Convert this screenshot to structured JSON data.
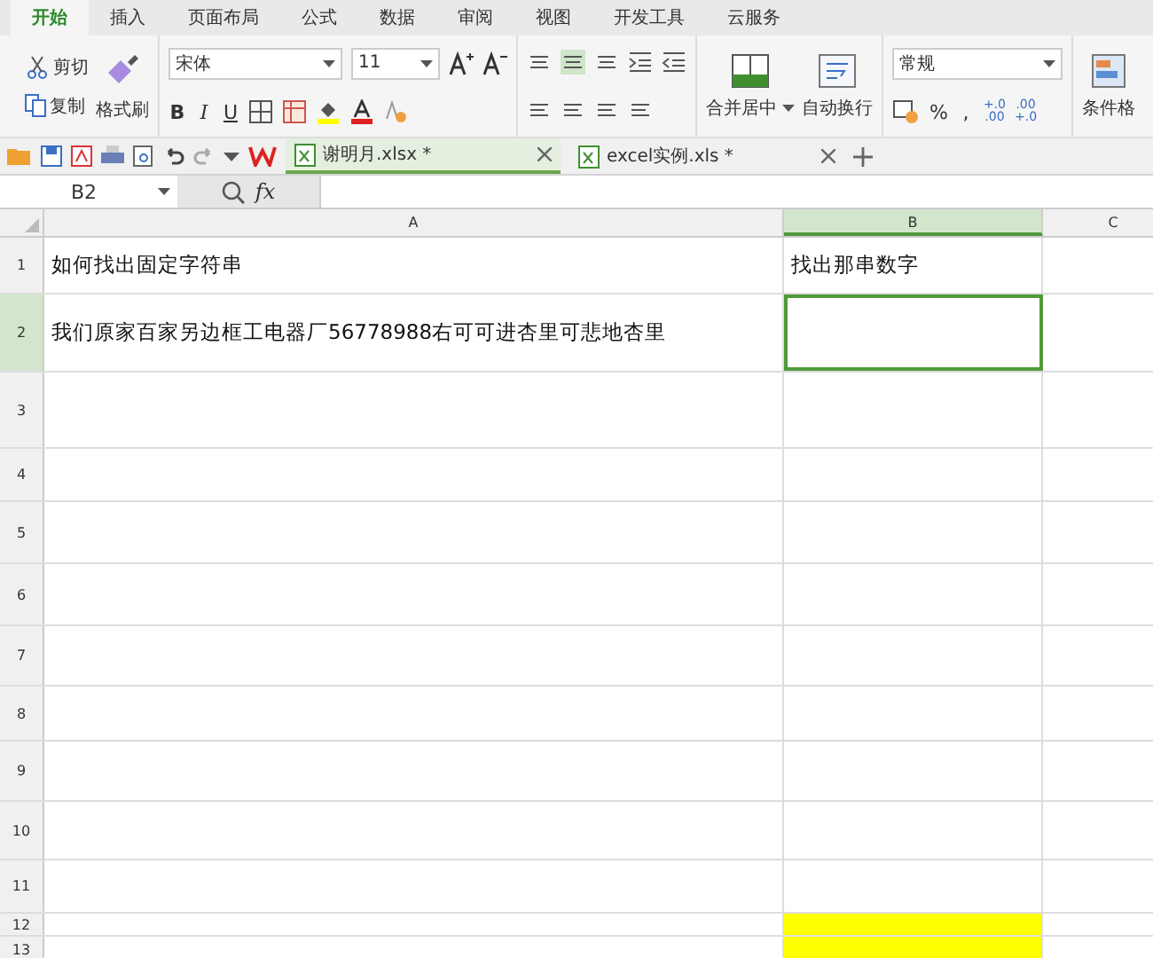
{
  "menu_tabs": [
    {
      "label": "开始",
      "selected": true
    },
    {
      "label": "插入",
      "selected": false
    },
    {
      "label": "页面布局",
      "selected": false
    },
    {
      "label": "公式",
      "selected": false
    },
    {
      "label": "数据",
      "selected": false
    },
    {
      "label": "审阅",
      "selected": false
    },
    {
      "label": "视图",
      "selected": false
    },
    {
      "label": "开发工具",
      "selected": false
    },
    {
      "label": "云服务",
      "selected": false
    }
  ],
  "clipboard": {
    "cut": "剪切",
    "copy": "复制",
    "format_painter": "格式刷"
  },
  "font": {
    "name": "宋体",
    "size": "11",
    "bold": "B",
    "italic": "I",
    "underline": "U"
  },
  "alignment": {
    "merge": "合并居中",
    "wrap": "自动换行"
  },
  "number": {
    "format": "常规",
    "percent": "%",
    "comma": ",",
    "increase": {
      "top": "+.0",
      "bottom": ".00"
    },
    "decrease": {
      "top": ".00",
      "bottom": "+.0"
    }
  },
  "conditional": "条件格",
  "documents": [
    {
      "name": "谢明月.xlsx *",
      "selected": true
    },
    {
      "name": "excel实例.xls *",
      "selected": false
    }
  ],
  "name_box": "B2",
  "formula_icon": "fx",
  "columns": [
    {
      "label": "A",
      "selected": false
    },
    {
      "label": "B",
      "selected": true
    },
    {
      "label": "C",
      "selected": false
    }
  ],
  "rows": [
    {
      "number": "1",
      "selected": false,
      "cells": [
        {
          "text": "如何找出固定字符串",
          "selected": false,
          "color": "#ffffff"
        },
        {
          "text": "找出那串数字",
          "selected": false,
          "color": "#ffffff"
        }
      ]
    },
    {
      "number": "2",
      "selected": true,
      "cells": [
        {
          "text": "我们原家百家另边框工电器厂56778988右可可进杏里可悲地杏里",
          "selected": false,
          "color": "#ffffff"
        },
        {
          "text": "",
          "selected": true,
          "color": "#ffffff"
        }
      ]
    },
    {
      "number": "3",
      "selected": false,
      "cells": [
        {
          "text": "",
          "selected": false,
          "color": "#ffffff"
        },
        {
          "text": "",
          "selected": false,
          "color": "#ffffff"
        }
      ]
    },
    {
      "number": "4",
      "selected": false,
      "cells": [
        {
          "text": "",
          "selected": false,
          "color": "#ffffff"
        },
        {
          "text": "",
          "selected": false,
          "color": "#ffffff"
        }
      ]
    },
    {
      "number": "5",
      "selected": false,
      "cells": [
        {
          "text": "",
          "selected": false,
          "color": "#ffffff"
        },
        {
          "text": "",
          "selected": false,
          "color": "#ffffff"
        }
      ]
    },
    {
      "number": "6",
      "selected": false,
      "cells": [
        {
          "text": "",
          "selected": false,
          "color": "#ffffff"
        },
        {
          "text": "",
          "selected": false,
          "color": "#ffffff"
        }
      ]
    },
    {
      "number": "7",
      "selected": false,
      "cells": [
        {
          "text": "",
          "selected": false,
          "color": "#ffffff"
        },
        {
          "text": "",
          "selected": false,
          "color": "#ffffff"
        }
      ]
    },
    {
      "number": "8",
      "selected": false,
      "cells": [
        {
          "text": "",
          "selected": false,
          "color": "#ffffff"
        },
        {
          "text": "",
          "selected": false,
          "color": "#ffffff"
        }
      ]
    },
    {
      "number": "9",
      "selected": false,
      "cells": [
        {
          "text": "",
          "selected": false,
          "color": "#ffffff"
        },
        {
          "text": "",
          "selected": false,
          "color": "#ffffff"
        }
      ]
    },
    {
      "number": "10",
      "selected": false,
      "cells": [
        {
          "text": "",
          "selected": false,
          "color": "#ffffff"
        },
        {
          "text": "",
          "selected": false,
          "color": "#ffffff"
        }
      ]
    },
    {
      "number": "11",
      "selected": false,
      "cells": [
        {
          "text": "",
          "selected": false,
          "color": "#ffffff"
        },
        {
          "text": "",
          "selected": false,
          "color": "#ffffff"
        }
      ]
    },
    {
      "number": "12",
      "selected": false,
      "cells": [
        {
          "text": "",
          "selected": false,
          "color": "#ffffff"
        },
        {
          "text": "",
          "selected": false,
          "color": "#ffff00"
        }
      ]
    },
    {
      "number": "13",
      "selected": false,
      "cells": [
        {
          "text": "",
          "selected": false,
          "color": "#ffffff"
        },
        {
          "text": "",
          "selected": false,
          "color": "#ffff00"
        }
      ]
    }
  ]
}
